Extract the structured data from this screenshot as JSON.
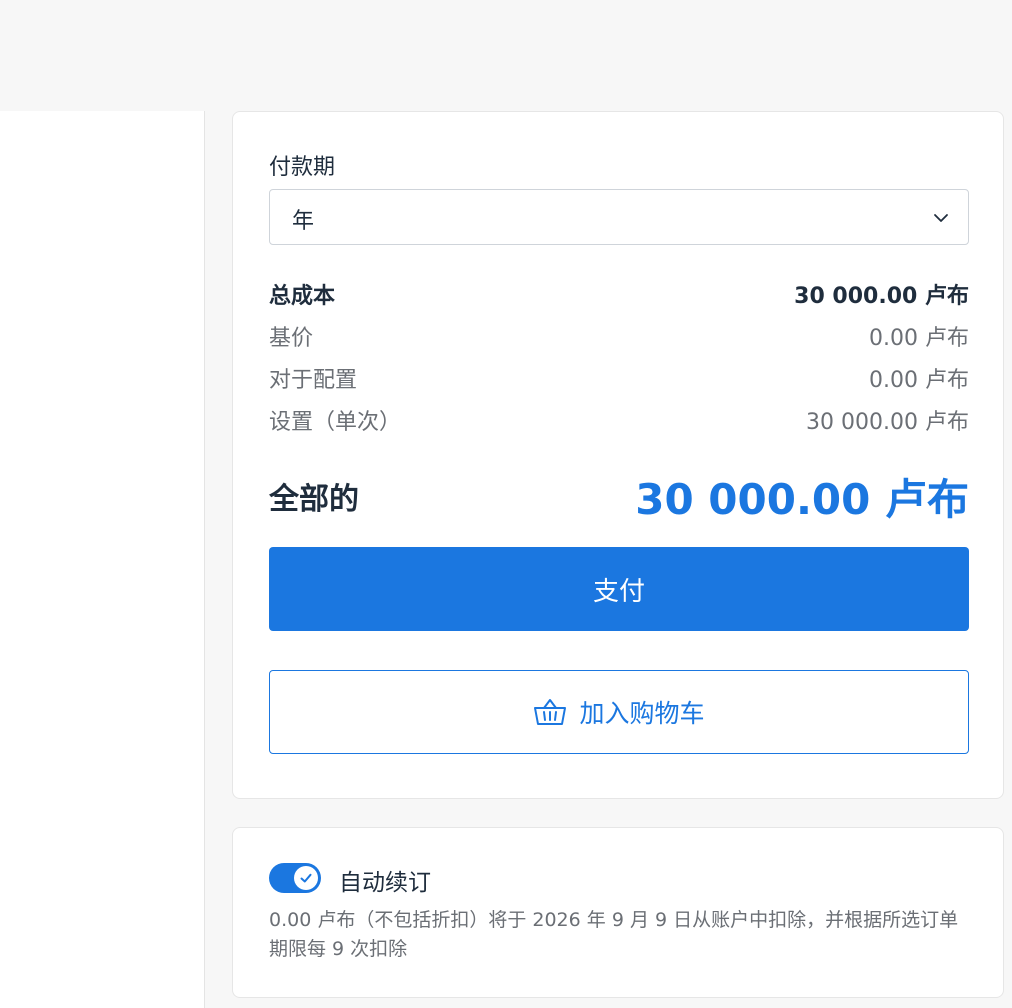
{
  "payment_period": {
    "label": "付款期",
    "selected": "年"
  },
  "costs": {
    "total_cost": {
      "label": "总成本",
      "value": "30 000.00 卢布"
    },
    "base_price": {
      "label": "基价",
      "value": "0.00 卢布"
    },
    "for_config": {
      "label": "对于配置",
      "value": "0.00 卢布"
    },
    "setup_once": {
      "label": "设置（单次）",
      "value": "30 000.00 卢布"
    }
  },
  "grand_total": {
    "label": "全部的",
    "value": "30 000.00 卢布"
  },
  "actions": {
    "pay_label": "支付",
    "add_to_cart_label": "加入购物车"
  },
  "auto_renew": {
    "enabled": true,
    "label": "自动续订",
    "description": "0.00 卢布（不包括折扣）将于 2026 年 9 月 9 日从账户中扣除，并根据所选订单期限每 9 次扣除"
  },
  "colors": {
    "accent": "#1b77e0",
    "background": "#f7f7f7",
    "text": "#1f2d3d",
    "muted": "#6b6f75"
  },
  "icons": [
    "chevron-down-icon",
    "basket-icon",
    "check-icon"
  ]
}
